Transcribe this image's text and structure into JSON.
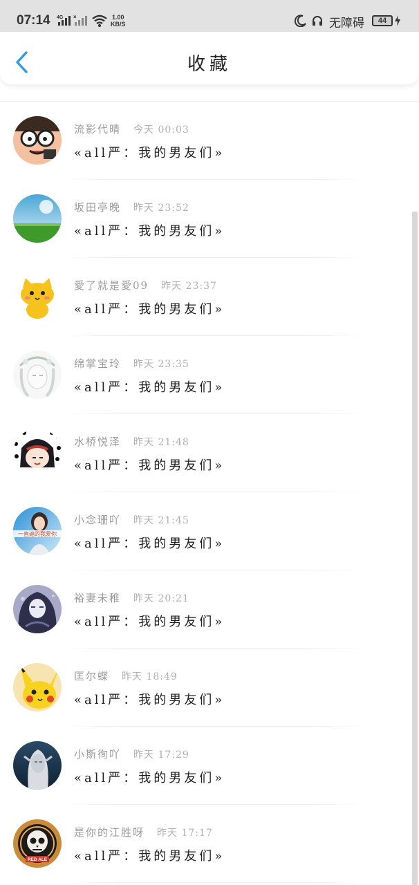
{
  "status_bar": {
    "time": "07:14",
    "network": "4G",
    "speed_value": "1.00",
    "speed_unit": "KB/S",
    "accessibility_label": "无障碍",
    "battery": "44"
  },
  "header": {
    "title": "收藏"
  },
  "items": [
    {
      "nickname": "流影代晴",
      "time": "今天 00:03",
      "title": "«all严：我的男友们»",
      "avatar_icon": "avatar-cartoon-glasses"
    },
    {
      "nickname": "坂田亭晚",
      "time": "昨天 23:52",
      "title": "«all严：我的男友们»",
      "avatar_icon": "avatar-landscape"
    },
    {
      "nickname": "愛了就是愛09",
      "time": "昨天 23:37",
      "title": "«all严：我的男友们»",
      "avatar_icon": "avatar-yellow-cat"
    },
    {
      "nickname": "绵掌宝玲",
      "time": "昨天 23:35",
      "title": "«all严：我的男友们»",
      "avatar_icon": "avatar-sketch-girl"
    },
    {
      "nickname": "水桥悦泽",
      "time": "昨天 21:48",
      "title": "«all严：我的男友们»",
      "avatar_icon": "avatar-anime-dots"
    },
    {
      "nickname": "小念珊吖",
      "time": "昨天 21:45",
      "title": "«all严：我的男友们»",
      "avatar_icon": "avatar-girl-banner",
      "avatar_text": "一直遍的我爱你"
    },
    {
      "nickname": "裕妻未稚",
      "time": "昨天 20:21",
      "title": "«all严：我的男友们»",
      "avatar_icon": "avatar-dark-anime"
    },
    {
      "nickname": "匡尔蝶",
      "time": "昨天 18:49",
      "title": "«all严：我的男友们»",
      "avatar_icon": "avatar-pikachu"
    },
    {
      "nickname": "小斯徇吖",
      "time": "昨天 17:29",
      "title": "«all严：我的男友们»",
      "avatar_icon": "avatar-elf"
    },
    {
      "nickname": "是你的江胜呀",
      "time": "昨天 17:17",
      "title": "«all严：我的男友们»",
      "avatar_icon": "avatar-skull",
      "avatar_text": "RED ALE"
    }
  ]
}
